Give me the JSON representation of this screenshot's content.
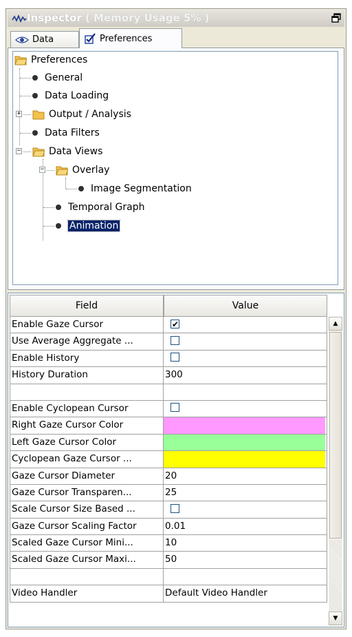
{
  "window": {
    "title_prefix": "Inspector",
    "title_memory": " ( Memory Usage 5% )"
  },
  "tabs": [
    {
      "label": "Data"
    },
    {
      "label": "Preferences"
    }
  ],
  "tree": {
    "root": "Preferences",
    "general": "General",
    "data_loading": "Data Loading",
    "output_analysis": "Output / Analysis",
    "data_filters": "Data Filters",
    "data_views": "Data Views",
    "overlay": "Overlay",
    "image_segmentation": "Image Segmentation",
    "temporal_graph": "Temporal Graph",
    "animation": "Animation"
  },
  "grid": {
    "header_field": "Field",
    "header_value": "Value",
    "rows": [
      {
        "field": "Enable Gaze Cursor",
        "type": "checkbox",
        "checked": true
      },
      {
        "field": "Use Average Aggregate ...",
        "type": "checkbox",
        "checked": false
      },
      {
        "field": "Enable History",
        "type": "checkbox",
        "checked": false
      },
      {
        "field": "History Duration",
        "type": "text",
        "value": "300"
      },
      {
        "field": "",
        "type": "text",
        "value": ""
      },
      {
        "field": "Enable Cyclopean Cursor",
        "type": "checkbox",
        "checked": false
      },
      {
        "field": "Right Gaze Cursor Color",
        "type": "color",
        "color": "#ff99ff"
      },
      {
        "field": "Left Gaze Cursor Color",
        "type": "color",
        "color": "#99ff99"
      },
      {
        "field": "Cyclopean Gaze Cursor ...",
        "type": "color",
        "color": "#ffff00"
      },
      {
        "field": "Gaze Cursor Diameter",
        "type": "text",
        "value": "20"
      },
      {
        "field": "Gaze Cursor Transparen...",
        "type": "text",
        "value": "25"
      },
      {
        "field": "Scale Cursor Size Based ...",
        "type": "checkbox",
        "checked": false
      },
      {
        "field": "Gaze Cursor Scaling Factor",
        "type": "text",
        "value": "0.01"
      },
      {
        "field": "Scaled Gaze Cursor Mini...",
        "type": "text",
        "value": "10"
      },
      {
        "field": "Scaled Gaze Cursor Maxi...",
        "type": "text",
        "value": "50"
      },
      {
        "field": "",
        "type": "text",
        "value": ""
      },
      {
        "field": "Video Handler",
        "type": "text",
        "value": "Default Video Handler"
      }
    ]
  },
  "colors": {
    "selection": "#0a246a",
    "folder": "#f2c14e"
  }
}
